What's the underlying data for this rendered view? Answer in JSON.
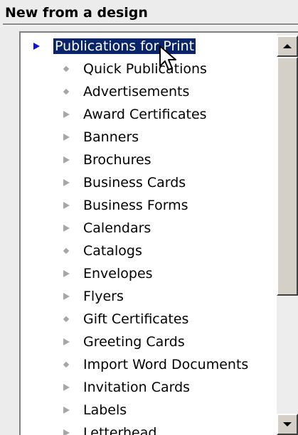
{
  "pane": {
    "title": "New from a design"
  },
  "tree": {
    "parent": {
      "label": "Publications for Print",
      "marker": "expanded-arrow-icon",
      "selected": true
    },
    "items": [
      {
        "label": "Quick Publications",
        "marker": "diamond-bullet-icon"
      },
      {
        "label": "Advertisements",
        "marker": "diamond-bullet-icon"
      },
      {
        "label": "Award Certificates",
        "marker": "collapsed-arrow-icon"
      },
      {
        "label": "Banners",
        "marker": "collapsed-arrow-icon"
      },
      {
        "label": "Brochures",
        "marker": "collapsed-arrow-icon"
      },
      {
        "label": "Business Cards",
        "marker": "collapsed-arrow-icon"
      },
      {
        "label": "Business Forms",
        "marker": "collapsed-arrow-icon"
      },
      {
        "label": "Calendars",
        "marker": "collapsed-arrow-icon"
      },
      {
        "label": "Catalogs",
        "marker": "diamond-bullet-icon"
      },
      {
        "label": "Envelopes",
        "marker": "collapsed-arrow-icon"
      },
      {
        "label": "Flyers",
        "marker": "collapsed-arrow-icon"
      },
      {
        "label": "Gift Certificates",
        "marker": "diamond-bullet-icon"
      },
      {
        "label": "Greeting Cards",
        "marker": "collapsed-arrow-icon"
      },
      {
        "label": "Import Word Documents",
        "marker": "diamond-bullet-icon"
      },
      {
        "label": "Invitation Cards",
        "marker": "collapsed-arrow-icon"
      },
      {
        "label": "Labels",
        "marker": "collapsed-arrow-icon"
      },
      {
        "label": "Letterhead",
        "marker": "collapsed-arrow-icon"
      }
    ]
  },
  "scrollbar": {
    "up_icon": "scroll-up-arrow-icon",
    "down_icon": "scroll-down-arrow-icon"
  },
  "colors": {
    "selection_bg": "#0a246a",
    "selection_text": "#ffffff",
    "expanded_marker": "#1010e0",
    "collapsed_marker": "#a6a6a6"
  },
  "cursor_icon": "mouse-pointer-icon"
}
